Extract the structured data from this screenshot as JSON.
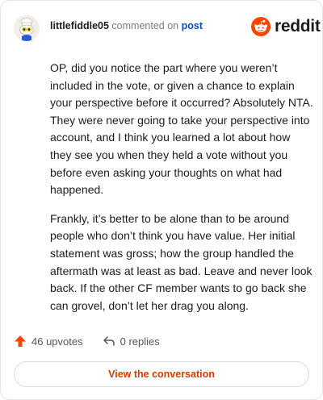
{
  "header": {
    "username": "littlefiddle05",
    "action_text": "commented on",
    "target_link": "post",
    "brand": "reddit"
  },
  "comment": {
    "paragraphs": [
      "OP, did you notice the part where you weren’t included in the vote, or given a chance to explain your perspective before it occurred? Absolutely NTA. They were never going to take your perspective into account, and I think you learned a lot about how they see you when they held a vote without you before even asking your thoughts on what had happened.",
      "Frankly, it’s better to be alone than to be around people who don’t think you have value. Her initial statement was gross; how the group handled the aftermath was at least as bad. Leave and never look back. If the other CF member wants to go back she can grovel, don’t let her drag you along."
    ]
  },
  "actions": {
    "upvotes": "46 upvotes",
    "replies": "0 replies"
  },
  "cta": {
    "label": "View the conversation"
  },
  "colors": {
    "upvote": "#ff4500",
    "link": "#0a4fb6",
    "cta_text": "#d93a00",
    "border": "#e3e4e6"
  },
  "icons": [
    "avatar-snoo-icon",
    "reddit-logo-icon",
    "upvote-arrow-icon",
    "reply-arrow-icon"
  ]
}
